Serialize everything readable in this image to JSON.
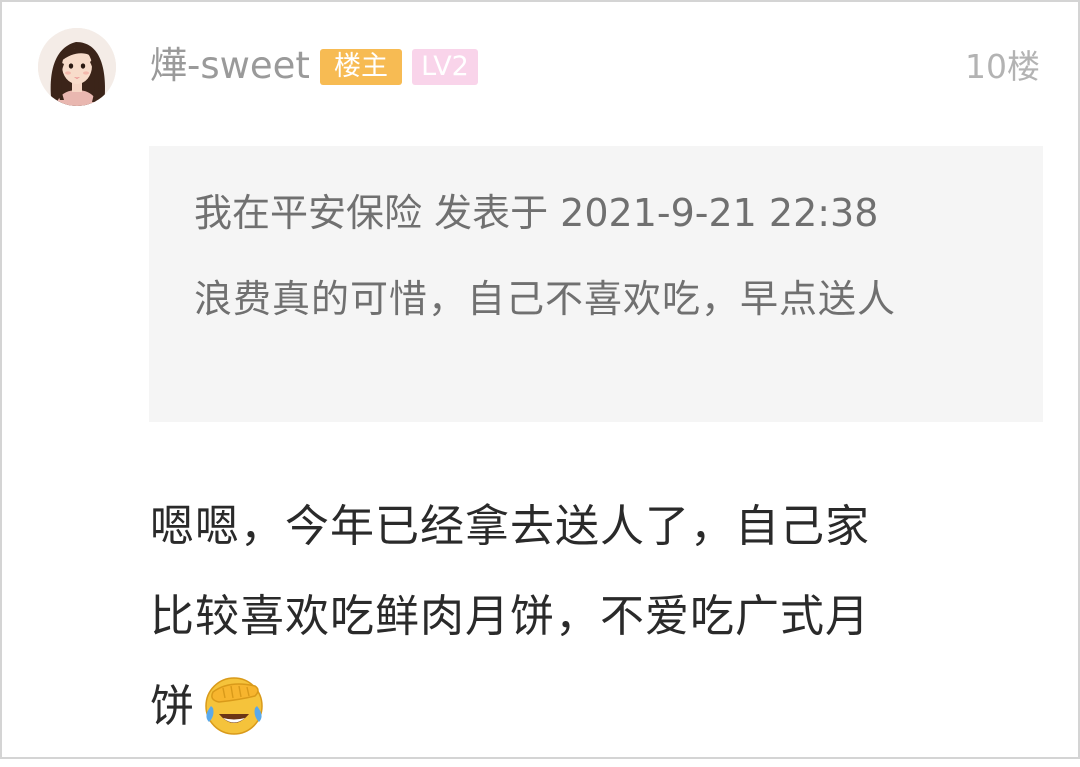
{
  "post": {
    "username": "燁-sweet",
    "badge_op": "楼主",
    "badge_level": "LV2",
    "floor": "10楼",
    "quote": {
      "header": "我在平安保险 发表于 2021-9-21 22:38",
      "body": "浪费真的可惜，自己不喜欢吃，早点送人"
    },
    "reply": {
      "line1": "嗯嗯，今年已经拿去送人了，自己家",
      "line2": "比较喜欢吃鲜肉月饼，不爱吃广式月",
      "line3": "饼",
      "emoji": "facepalm-laughing-emoji"
    }
  },
  "colors": {
    "badge_op": "#f7bb53",
    "badge_level": "#f9d4ea",
    "quote_bg": "#f5f5f5",
    "username": "#9a9a9a"
  }
}
